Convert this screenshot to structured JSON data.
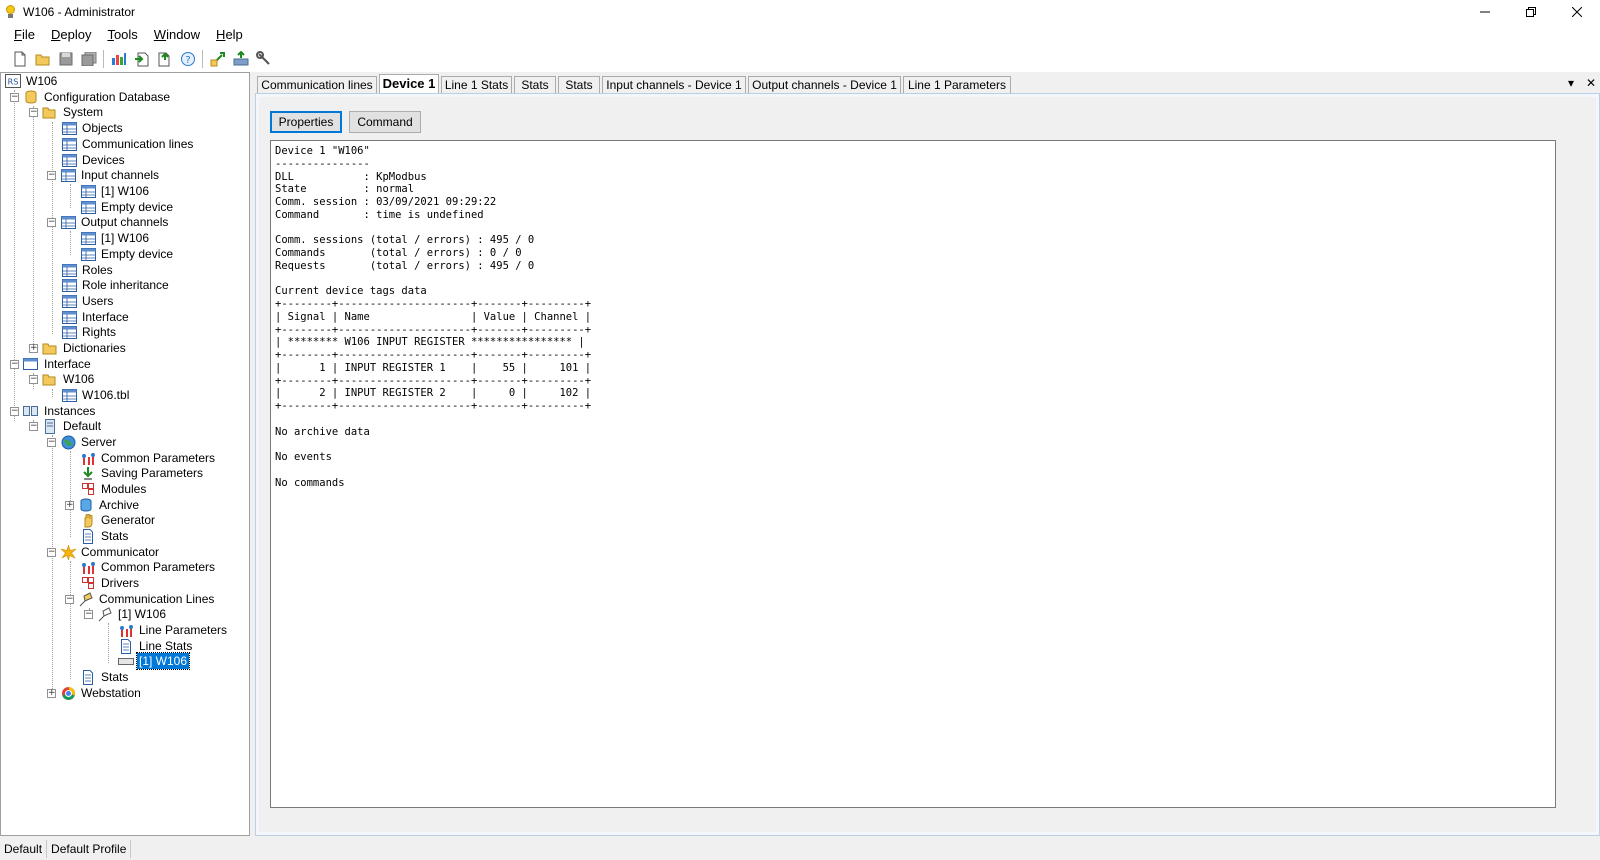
{
  "window": {
    "title": "W106 - Administrator",
    "controls": [
      "minimize-icon",
      "restore-icon",
      "close-icon"
    ]
  },
  "menu": [
    {
      "label": "File",
      "underline": "F",
      "rest": "ile"
    },
    {
      "label": "Deploy",
      "underline": "D",
      "rest": "eploy"
    },
    {
      "label": "Tools",
      "underline": "T",
      "rest": "ools"
    },
    {
      "label": "Window",
      "underline": "W",
      "rest": "indow"
    },
    {
      "label": "Help",
      "underline": "H",
      "rest": "elp"
    }
  ],
  "toolbar": {
    "buttons": [
      "new-file-icon",
      "open-folder-icon",
      "save-icon",
      "save-all-icon",
      "chart-icon",
      "import-icon",
      "export-icon",
      "help-icon",
      "pass-icon",
      "upload-icon",
      "wrench-icon"
    ]
  },
  "tree": {
    "root": "W106",
    "config_db": "Configuration Database",
    "system": "System",
    "objects": "Objects",
    "comm_lines": "Communication lines",
    "devices": "Devices",
    "input_channels": "Input channels",
    "in_w106": "[1] W106",
    "in_empty": "Empty device",
    "output_channels": "Output channels",
    "out_w106": "[1] W106",
    "out_empty": "Empty device",
    "roles": "Roles",
    "role_inheritance": "Role inheritance",
    "users": "Users",
    "interface": "Interface",
    "rights": "Rights",
    "dictionaries": "Dictionaries",
    "interface_root": "Interface",
    "w106_folder": "W106",
    "w106_tbl": "W106.tbl",
    "instances": "Instances",
    "default": "Default",
    "server": "Server",
    "srv_common_params": "Common Parameters",
    "srv_saving_params": "Saving Parameters",
    "srv_modules": "Modules",
    "srv_archive": "Archive",
    "srv_generator": "Generator",
    "srv_stats": "Stats",
    "communicator": "Communicator",
    "comm_common_params": "Common Parameters",
    "comm_drivers": "Drivers",
    "comm_comm_lines": "Communication Lines",
    "comm_line_w106": "[1] W106",
    "line_parameters": "Line Parameters",
    "line_stats": "Line Stats",
    "line_device_w106": "[1] W106",
    "comm_stats": "Stats",
    "webstation": "Webstation"
  },
  "tabs": [
    {
      "label": "Communication lines",
      "active": false
    },
    {
      "label": "Device 1",
      "active": true
    },
    {
      "label": "Line 1 Stats",
      "active": false
    },
    {
      "label": "Stats",
      "active": false
    },
    {
      "label": "Stats",
      "active": false
    },
    {
      "label": "Input channels - Device 1",
      "active": false
    },
    {
      "label": "Output channels - Device 1",
      "active": false
    },
    {
      "label": "Line 1 Parameters",
      "active": false
    }
  ],
  "tab_extras": {
    "dropdown": "▾",
    "close": "✕"
  },
  "doc": {
    "properties_button": "Properties",
    "command_button": "Command",
    "device_text": "Device 1 \"W106\"\n---------------\nDLL           : KpModbus\nState         : normal\nComm. session : 03/09/2021 09:29:22\nCommand       : time is undefined\n\nComm. sessions (total / errors) : 495 / 0\nCommands       (total / errors) : 0 / 0\nRequests       (total / errors) : 495 / 0\n\nCurrent device tags data\n+--------+---------------------+-------+---------+\n| Signal | Name                | Value | Channel |\n+--------+---------------------+-------+---------+\n| ******** W106 INPUT REGISTER **************** |\n+--------+---------------------+-------+---------+\n|      1 | INPUT REGISTER 1    |    55 |     101 |\n+--------+---------------------+-------+---------+\n|      2 | INPUT REGISTER 2    |     0 |     102 |\n+--------+---------------------+-------+---------+\n\nNo archive data\n\nNo events\n\nNo commands"
  },
  "status": {
    "instance": "Default",
    "profile": "Default Profile"
  }
}
